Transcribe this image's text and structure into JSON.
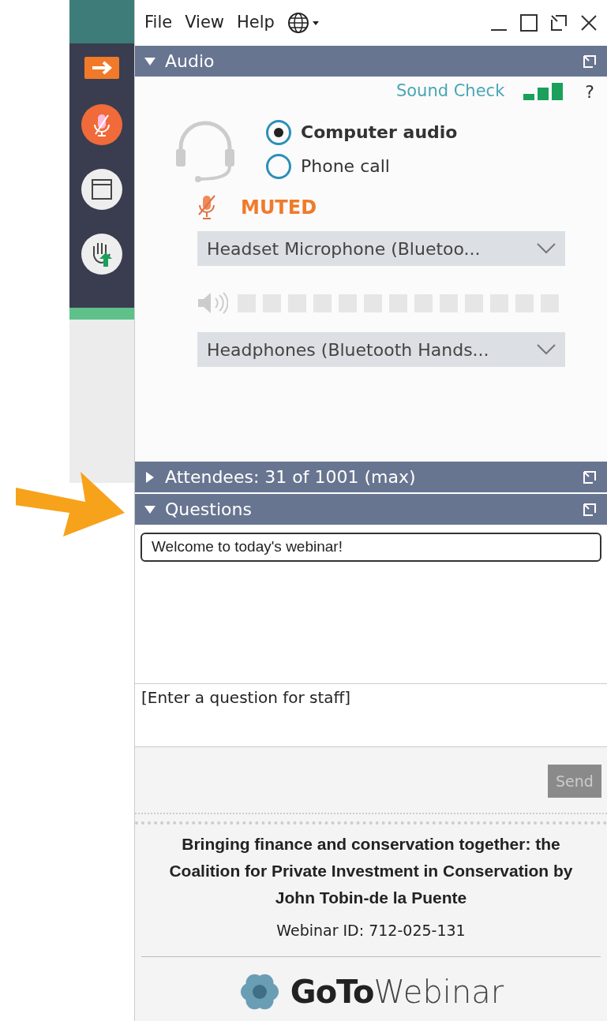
{
  "menu": [
    "File",
    "View",
    "Help"
  ],
  "audio": {
    "title": "Audio",
    "expanded": true,
    "sound_check": "Sound Check",
    "help": "?",
    "options": [
      {
        "label": "Computer audio",
        "selected": true
      },
      {
        "label": "Phone call",
        "selected": false
      }
    ],
    "mic_status": "MUTED",
    "muted": true,
    "microphone": "Headset Microphone  (Bluetoo...",
    "speaker_meter": {
      "level": 0
    },
    "speaker": "Headphones  (Bluetooth  Hands..."
  },
  "attendees": {
    "title": "Attendees:  31 of 1001 (max)",
    "expanded": false
  },
  "questions": {
    "title": "Questions",
    "expanded": true,
    "messages": [
      "Welcome to today's webinar!"
    ],
    "placeholder": "[Enter a question for staff]",
    "send": "Send",
    "send_disabled": true
  },
  "footer": {
    "title": "Bringing finance and conservation together: the Coalition for Private Investment in Conservation by John Tobin-de la Puente",
    "webinar_id": "Webinar ID: 712-025-131",
    "brand_bold": "GoTo",
    "brand_light": "Webinar"
  }
}
